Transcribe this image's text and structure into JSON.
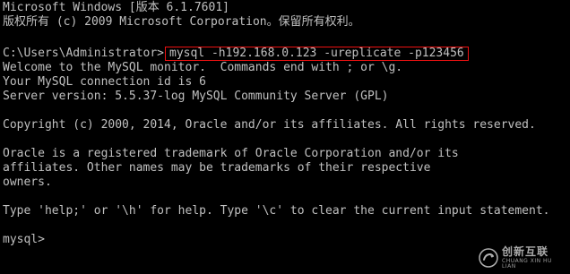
{
  "terminal": {
    "lines": [
      "Microsoft Windows [版本 6.1.7601]",
      "版权所有 (c) 2009 Microsoft Corporation。保留所有权利。",
      "Welcome to the MySQL monitor.  Commands end with ; or \\g.",
      "Your MySQL connection id is 6",
      "Server version: 5.5.37-log MySQL Community Server (GPL)",
      "Copyright (c) 2000, 2014, Oracle and/or its affiliates. All rights reserved.",
      "Oracle is a registered trademark of Oracle Corporation and/or its",
      "affiliates. Other names may be trademarks of their respective",
      "owners.",
      "Type 'help;' or '\\h' for help. Type '\\c' to clear the current input statement.",
      "mysql>"
    ],
    "prompt_path": "C:\\Users\\Administrator>",
    "command": "mysql -h192.168.0.123 -ureplicate -p123456",
    "highlight_color": "#ee1111"
  },
  "watermark": {
    "cn": "创新互联",
    "en": "CHUANG XIN HU LIAN",
    "icon": "chuangxin-logo-icon"
  }
}
